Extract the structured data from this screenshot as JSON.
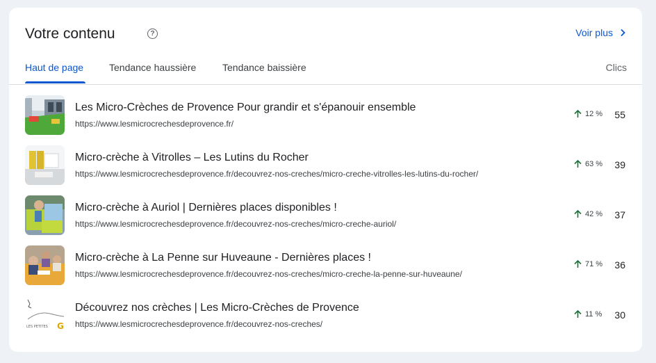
{
  "header": {
    "title": "Votre contenu",
    "help_icon": "help-circle-icon",
    "view_more_label": "Voir plus",
    "view_more_icon": "chevron-right-icon"
  },
  "tabs": [
    {
      "label": "Haut de page",
      "active": true
    },
    {
      "label": "Tendance haussière",
      "active": false
    },
    {
      "label": "Tendance baissière",
      "active": false
    }
  ],
  "column_label": "Clics",
  "accent_color": "#0b57d0",
  "trend_color": "#137333",
  "rows": [
    {
      "title": "Les Micro-Crèches de Provence Pour grandir et s'épanouir ensemble",
      "url": "https://www.lesmicrocrechesdeprovence.fr/",
      "trend": "12 %",
      "clicks": "55"
    },
    {
      "title": "Micro-crèche à Vitrolles – Les Lutins du Rocher",
      "url": "https://www.lesmicrocrechesdeprovence.fr/decouvrez-nos-creches/micro-creche-vitrolles-les-lutins-du-rocher/",
      "trend": "63 %",
      "clicks": "39"
    },
    {
      "title": "Micro-crèche à Auriol | Dernières places disponibles !",
      "url": "https://www.lesmicrocrechesdeprovence.fr/decouvrez-nos-creches/micro-creche-auriol/",
      "trend": "42 %",
      "clicks": "37"
    },
    {
      "title": "Micro-crèche à La Penne sur Huveaune - Dernières places !",
      "url": "https://www.lesmicrocrechesdeprovence.fr/decouvrez-nos-creches/micro-creche-la-penne-sur-huveaune/",
      "trend": "71 %",
      "clicks": "36"
    },
    {
      "title": "Découvrez nos crèches | Les Micro-Crèches de Provence",
      "url": "https://www.lesmicrocrechesdeprovence.fr/decouvrez-nos-creches/",
      "trend": "11 %",
      "clicks": "30",
      "logo_text": "LES PETITES"
    }
  ]
}
